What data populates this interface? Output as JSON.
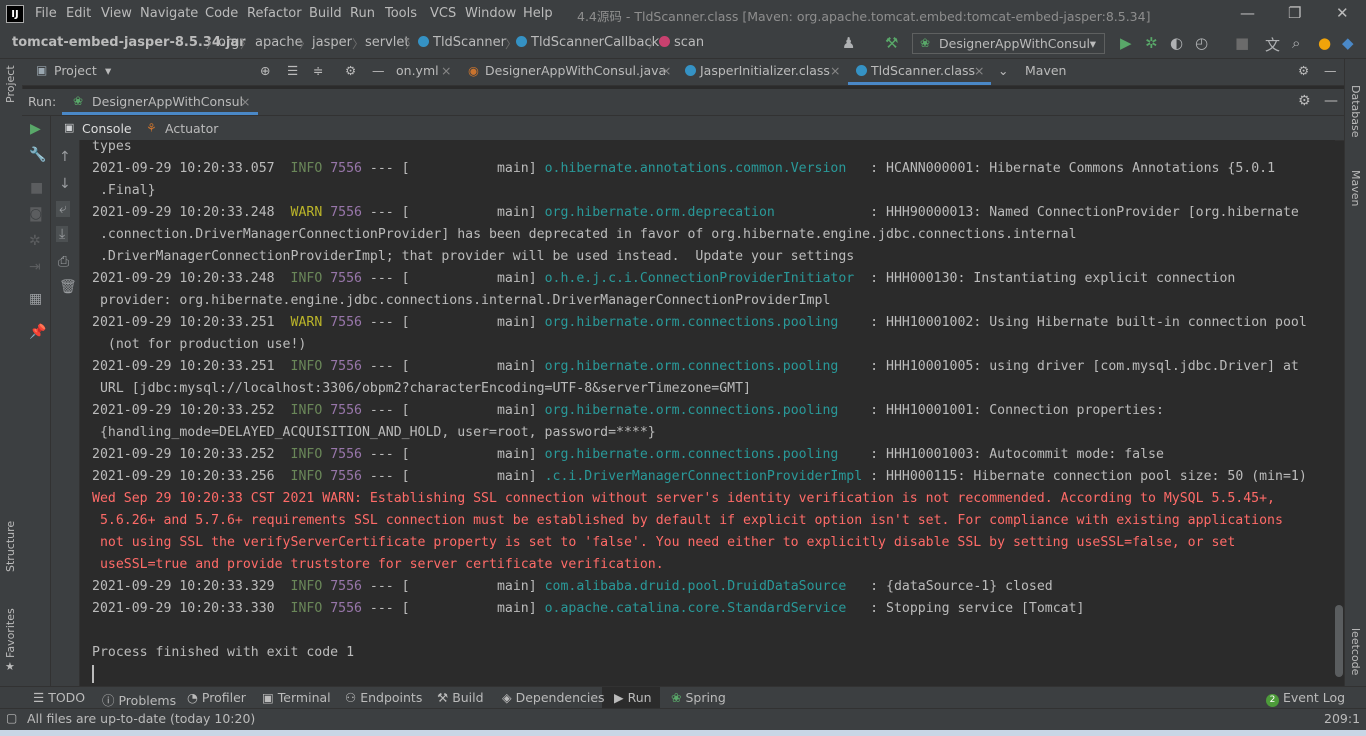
{
  "menubar": {
    "items": [
      "File",
      "Edit",
      "View",
      "Navigate",
      "Code",
      "Refactor",
      "Build",
      "Run",
      "Tools",
      "VCS",
      "Window",
      "Help"
    ],
    "window_title": "4.4源码 - TldScanner.class [Maven: org.apache.tomcat.embed:tomcat-embed-jasper:8.5.34]"
  },
  "breadcrumb": [
    "tomcat-embed-jasper-8.5.34.jar",
    "org",
    "apache",
    "jasper",
    "servlet",
    "TldScanner",
    "TldScannerCallback",
    "scan"
  ],
  "run_config": "DesignerAppWithConsul",
  "project_panel": {
    "label": "Project"
  },
  "editor_tabs": [
    {
      "label": "on.yml"
    },
    {
      "label": "DesignerAppWithConsul.java"
    },
    {
      "label": "JasperInitializer.class"
    },
    {
      "label": "TldScanner.class"
    }
  ],
  "maven_panel_label": "Maven",
  "left_stripe": {
    "project": "Project",
    "structure": "Structure",
    "favorites": "Favorites"
  },
  "right_stripe": {
    "database": "Database",
    "maven": "Maven",
    "leetcode": "leetcode"
  },
  "run_panel": {
    "label": "Run:",
    "tab": "DesignerAppWithConsul",
    "subtabs": [
      "Console",
      "Actuator"
    ]
  },
  "console_lines": [
    {
      "text": "types"
    },
    {
      "ts": "2021-09-29 10:20:33.057",
      "lvl": "INFO",
      "pid": "7556",
      "thread": " --- [           main] ",
      "logger": "o.hibernate.annotations.common.Version  ",
      "msg": " : HCANN000001: Hibernate Commons Annotations {5.0.1"
    },
    {
      "text": " .Final}"
    },
    {
      "ts": "2021-09-29 10:20:33.248",
      "lvl": "WARN",
      "pid": "7556",
      "thread": " --- [           main] ",
      "logger": "org.hibernate.orm.deprecation           ",
      "msg": " : HHH90000013: Named ConnectionProvider [org.hibernate"
    },
    {
      "text": " .connection.DriverManagerConnectionProvider] has been deprecated in favor of org.hibernate.engine.jdbc.connections.internal"
    },
    {
      "text": " .DriverManagerConnectionProviderImpl; that provider will be used instead.  Update your settings"
    },
    {
      "ts": "2021-09-29 10:20:33.248",
      "lvl": "INFO",
      "pid": "7556",
      "thread": " --- [           main] ",
      "logger": "o.h.e.j.c.i.ConnectionProviderInitiator ",
      "msg": " : HHH000130: Instantiating explicit connection"
    },
    {
      "text": " provider: org.hibernate.engine.jdbc.connections.internal.DriverManagerConnectionProviderImpl"
    },
    {
      "ts": "2021-09-29 10:20:33.251",
      "lvl": "WARN",
      "pid": "7556",
      "thread": " --- [           main] ",
      "logger": "org.hibernate.orm.connections.pooling   ",
      "msg": " : HHH10001002: Using Hibernate built-in connection pool"
    },
    {
      "text": "  (not for production use!)"
    },
    {
      "ts": "2021-09-29 10:20:33.251",
      "lvl": "INFO",
      "pid": "7556",
      "thread": " --- [           main] ",
      "logger": "org.hibernate.orm.connections.pooling   ",
      "msg": " : HHH10001005: using driver [com.mysql.jdbc.Driver] at"
    },
    {
      "text": " URL [jdbc:mysql://localhost:3306/obpm2?characterEncoding=UTF-8&serverTimezone=GMT]"
    },
    {
      "ts": "2021-09-29 10:20:33.252",
      "lvl": "INFO",
      "pid": "7556",
      "thread": " --- [           main] ",
      "logger": "org.hibernate.orm.connections.pooling   ",
      "msg": " : HHH10001001: Connection properties:"
    },
    {
      "text": " {handling_mode=DELAYED_ACQUISITION_AND_HOLD, user=root, password=****}"
    },
    {
      "ts": "2021-09-29 10:20:33.252",
      "lvl": "INFO",
      "pid": "7556",
      "thread": " --- [           main] ",
      "logger": "org.hibernate.orm.connections.pooling   ",
      "msg": " : HHH10001003: Autocommit mode: false"
    },
    {
      "ts": "2021-09-29 10:20:33.256",
      "lvl": "INFO",
      "pid": "7556",
      "thread": " --- [           main] ",
      "logger": ".c.i.DriverManagerConnectionProviderImpl",
      "msg": " : HHH000115: Hibernate connection pool size: 50 (min=1)"
    },
    {
      "err": "Wed Sep 29 10:20:33 CST 2021 WARN: Establishing SSL connection without server's identity verification is not recommended. According to MySQL 5.5.45+,"
    },
    {
      "err": " 5.6.26+ and 5.7.6+ requirements SSL connection must be established by default if explicit option isn't set. For compliance with existing applications"
    },
    {
      "err": " not using SSL the verifyServerCertificate property is set to 'false'. You need either to explicitly disable SSL by setting useSSL=false, or set"
    },
    {
      "err": " useSSL=true and provide truststore for server certificate verification."
    },
    {
      "ts": "2021-09-29 10:20:33.329",
      "lvl": "INFO",
      "pid": "7556",
      "thread": " --- [           main] ",
      "logger": "com.alibaba.druid.pool.DruidDataSource  ",
      "msg": " : {dataSource-1} closed"
    },
    {
      "ts": "2021-09-29 10:20:33.330",
      "lvl": "INFO",
      "pid": "7556",
      "thread": " --- [           main] ",
      "logger": "o.apache.catalina.core.StandardService  ",
      "msg": " : Stopping service [Tomcat]"
    },
    {
      "text": ""
    },
    {
      "text": "Process finished with exit code 1"
    }
  ],
  "bottom_tools": [
    "TODO",
    "Problems",
    "Profiler",
    "Terminal",
    "Endpoints",
    "Build",
    "Dependencies",
    "Run",
    "Spring"
  ],
  "event_log": {
    "badge": "2",
    "label": "Event Log"
  },
  "status": {
    "text": "All files are up-to-date (today 10:20)",
    "position": "209:1"
  },
  "colors": {
    "info": "#6a8759",
    "warn": "#bbb529",
    "logger": "#299999",
    "pid": "#9876aa",
    "error": "#ff6b68",
    "accent": "#4a88c7"
  }
}
